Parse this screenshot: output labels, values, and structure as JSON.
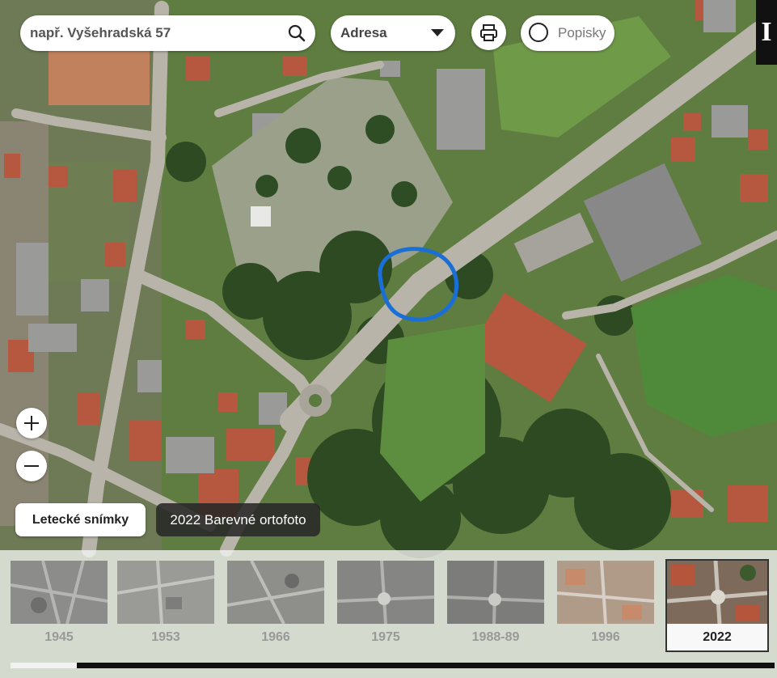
{
  "search": {
    "placeholder": "např. Vyšehradská 57"
  },
  "search_type": {
    "value": "Adresa"
  },
  "labels_toggle": {
    "label": "Popisky",
    "checked": false
  },
  "logo": {
    "text": "I"
  },
  "layer": {
    "button_label": "Letecké snímky",
    "current_name": "2022 Barevné ortofoto"
  },
  "timeline": {
    "years": [
      "1945",
      "1953",
      "1966",
      "1975",
      "1988-89",
      "1996",
      "2022"
    ],
    "active": "2022",
    "scroll_position": 0.08
  },
  "icons": [
    "search-icon",
    "chevron-down-icon",
    "printer-icon",
    "radio-icon",
    "plus-icon",
    "minus-icon"
  ],
  "colors": {
    "highlight_circle": "#1a6fd6",
    "timeline_bg": "#f2f2f2",
    "dark_chip": "#282828"
  }
}
